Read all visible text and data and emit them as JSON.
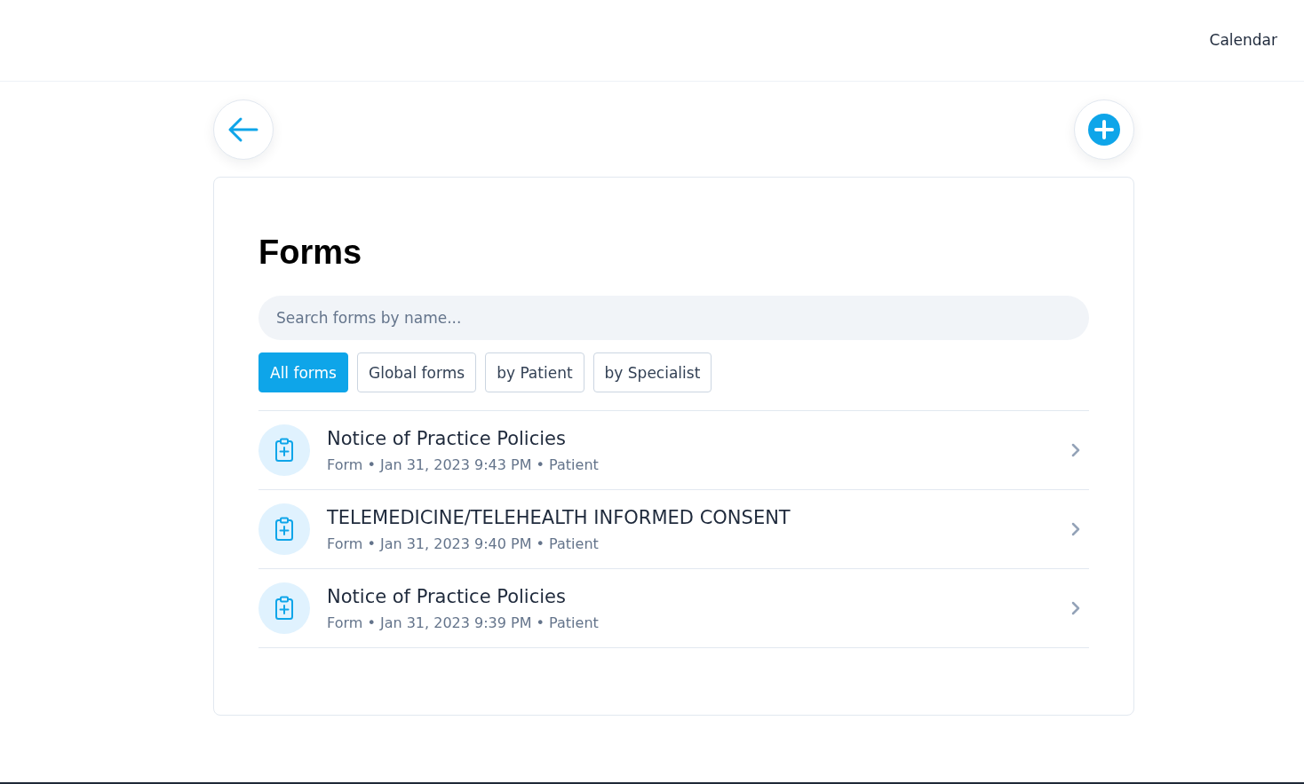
{
  "header": {
    "nav_link": "Calendar"
  },
  "title": "Forms",
  "search": {
    "placeholder": "Search forms by name..."
  },
  "filters": [
    {
      "label": "All forms",
      "selected": true
    },
    {
      "label": "Global forms",
      "selected": false
    },
    {
      "label": "by Patient",
      "selected": false
    },
    {
      "label": "by Specialist",
      "selected": false
    }
  ],
  "forms": [
    {
      "name": "Notice of Practice Policies",
      "meta": "Form • Jan 31, 2023 9:43 PM • Patient"
    },
    {
      "name": "TELEMEDICINE/TELEHEALTH INFORMED CONSENT",
      "meta": "Form • Jan 31, 2023 9:40 PM • Patient"
    },
    {
      "name": "Notice of Practice Policies",
      "meta": "Form • Jan 31, 2023 9:39 PM • Patient"
    }
  ]
}
